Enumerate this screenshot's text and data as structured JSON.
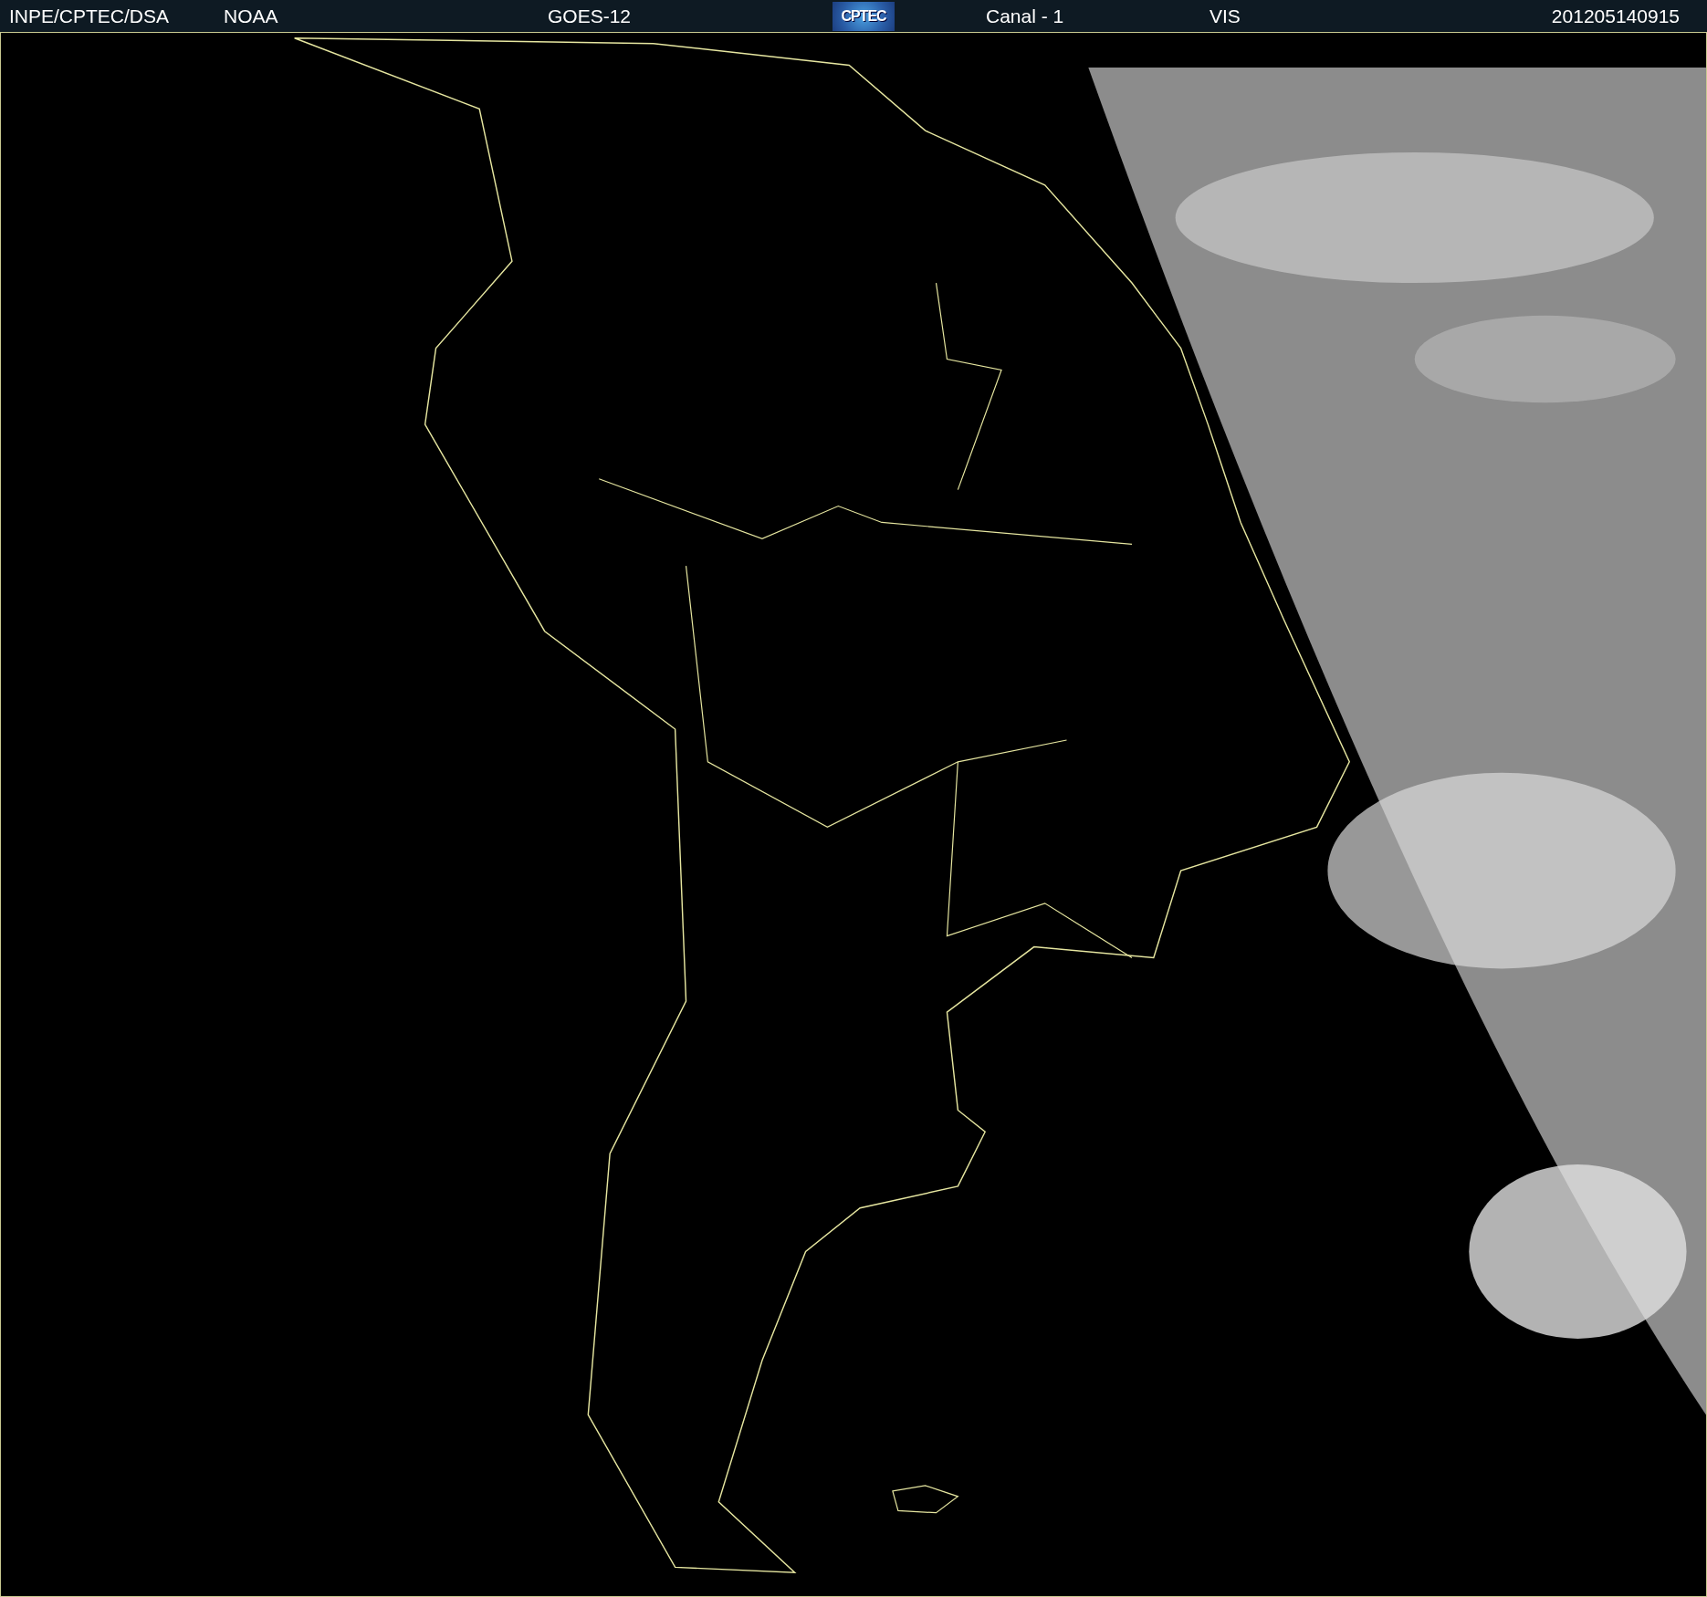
{
  "header": {
    "items": [
      {
        "kind": "text",
        "text": "INPE/CPTEC/DSA"
      },
      {
        "kind": "text",
        "text": "NOAA"
      },
      {
        "kind": "text",
        "text": "GOES-12"
      },
      {
        "kind": "logo",
        "text": "CPTEC"
      },
      {
        "kind": "text",
        "text": "Canal - 1"
      },
      {
        "kind": "text",
        "text": "VIS"
      },
      {
        "kind": "text",
        "text": "201205140915"
      }
    ]
  }
}
